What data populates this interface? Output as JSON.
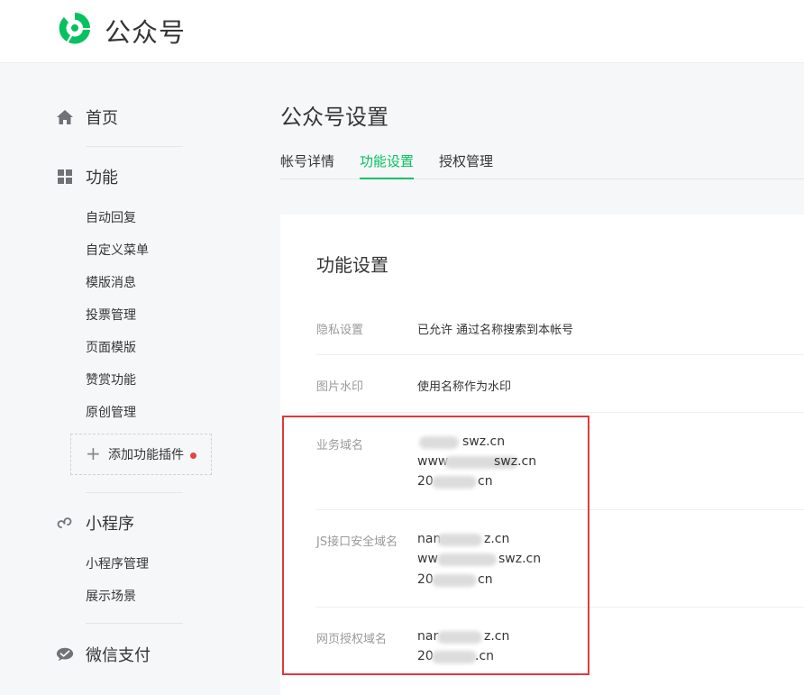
{
  "header": {
    "brand": "公众号",
    "icon": "wechat-official-account-logo",
    "brand_color": "#07c160"
  },
  "sidebar": {
    "sections": [
      {
        "label": "首页",
        "icon": "home-icon",
        "items": []
      },
      {
        "label": "功能",
        "icon": "grid-icon",
        "items": [
          "自动回复",
          "自定义菜单",
          "模版消息",
          "投票管理",
          "页面模版",
          "赞赏功能",
          "原创管理"
        ]
      },
      {
        "label": "小程序",
        "icon": "mini-program-icon",
        "items": [
          "小程序管理",
          "展示场景"
        ]
      },
      {
        "label": "微信支付",
        "icon": "wechat-pay-icon",
        "items": []
      }
    ],
    "add_plugin": {
      "label": "添加功能插件",
      "badge_color": "#e64340"
    }
  },
  "main": {
    "title": "公众号设置",
    "tabs": [
      {
        "label": "帐号详情",
        "active": false
      },
      {
        "label": "功能设置",
        "active": true
      },
      {
        "label": "授权管理",
        "active": false
      }
    ],
    "card": {
      "title": "功能设置",
      "rows": [
        {
          "label": "隐私设置",
          "value": "已允许 通过名称搜索到本帐号"
        },
        {
          "label": "图片水印",
          "value": "使用名称作为水印"
        }
      ],
      "domains": [
        {
          "label": "业务域名",
          "values": [
            {
              "prefix": "",
              "suffix": "swz.cn"
            },
            {
              "prefix": "www",
              "suffix": "swz.cn"
            },
            {
              "prefix": "20",
              "suffix": "cn"
            }
          ]
        },
        {
          "label": "JS接口安全域名",
          "values": [
            {
              "prefix": "nan",
              "suffix": "z.cn"
            },
            {
              "prefix": "ww",
              "suffix": "swz.cn"
            },
            {
              "prefix": "20",
              "suffix": "cn"
            }
          ]
        },
        {
          "label": "网页授权域名",
          "values": [
            {
              "prefix": "nar",
              "suffix": "z.cn"
            },
            {
              "prefix": "20",
              "suffix": ".cn"
            }
          ]
        }
      ]
    }
  },
  "colors": {
    "accent": "#07c160",
    "highlight": "#e0393e"
  }
}
